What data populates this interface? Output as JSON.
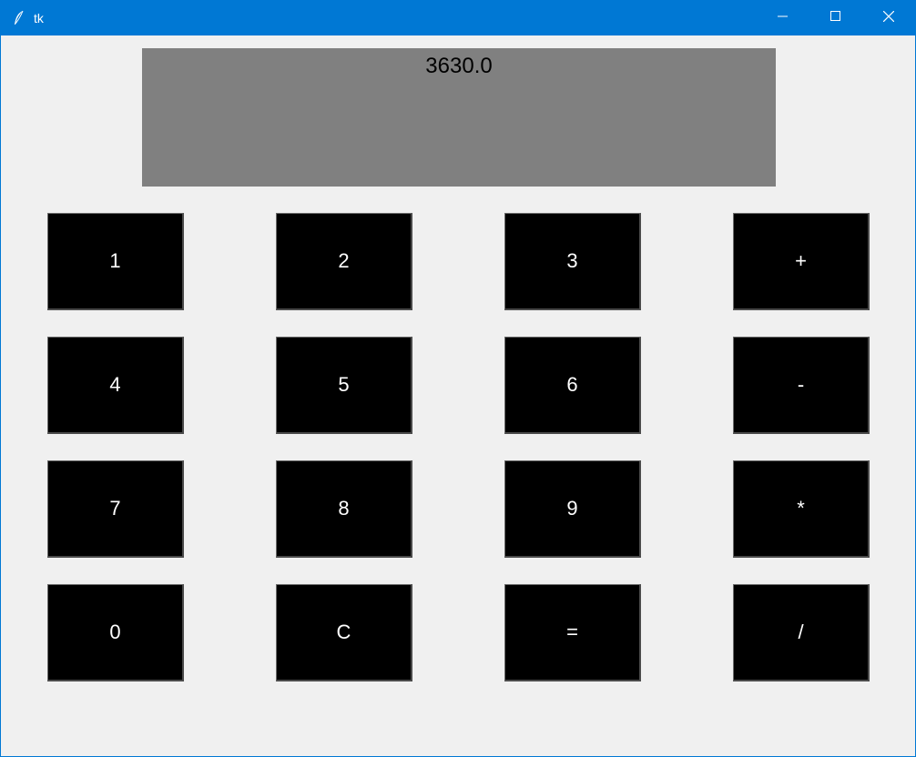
{
  "window": {
    "title": "tk",
    "titlebar_color": "#0078d4",
    "background_color": "#f0f0f0",
    "icons": [
      "feather-icon",
      "minimize-icon",
      "maximize-icon",
      "close-icon"
    ]
  },
  "display": {
    "value": "3630.0",
    "background_color": "#808080"
  },
  "keypad": {
    "button_color": "#000000",
    "text_color": "#ffffff",
    "rows": [
      [
        "1",
        "2",
        "3",
        "+"
      ],
      [
        "4",
        "5",
        "6",
        "-"
      ],
      [
        "7",
        "8",
        "9",
        "*"
      ],
      [
        "0",
        "C",
        "=",
        "/"
      ]
    ]
  }
}
